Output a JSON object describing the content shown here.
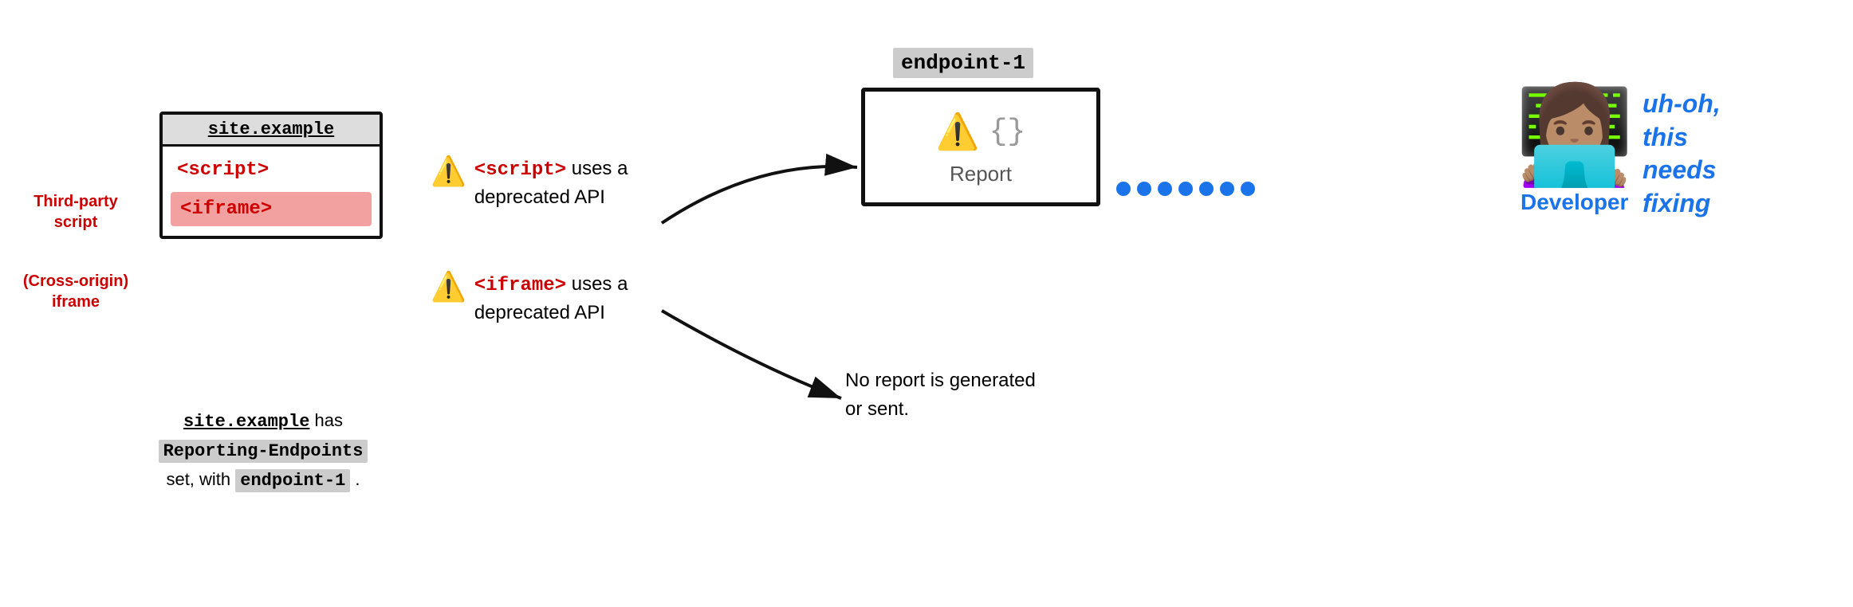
{
  "browser": {
    "title": "site.example",
    "script_tag": "<script>",
    "iframe_tag": "<iframe>"
  },
  "labels": {
    "third_party": "Third-party\nscript",
    "cross_origin": "(Cross-origin)\niframe"
  },
  "caption": {
    "part1": "site.example",
    "part2": " has ",
    "part3": "Reporting-Endpoints",
    "part4": " set, with ",
    "part5": "endpoint-1",
    "part6": " ."
  },
  "warning_script": {
    "icon": "⚠️",
    "text_before": "<script>",
    "text_after": " uses a deprecated API"
  },
  "warning_iframe": {
    "icon": "⚠️",
    "text_before": "<iframe>",
    "text_after": " uses a deprecated API"
  },
  "endpoint": {
    "label": "endpoint-1",
    "icon_warning": "⚠️",
    "icon_json": "{}",
    "report_label": "Report"
  },
  "no_report": {
    "text": "No report is generated or sent."
  },
  "developer": {
    "emoji": "👩🏽‍💻",
    "label": "Developer",
    "uh_oh": "uh-oh,\nthis\nneeds\nfixing"
  },
  "arrows": {
    "arrow1_label": "arrow from warnings to endpoint",
    "arrow2_label": "arrow from warnings to no-report"
  }
}
